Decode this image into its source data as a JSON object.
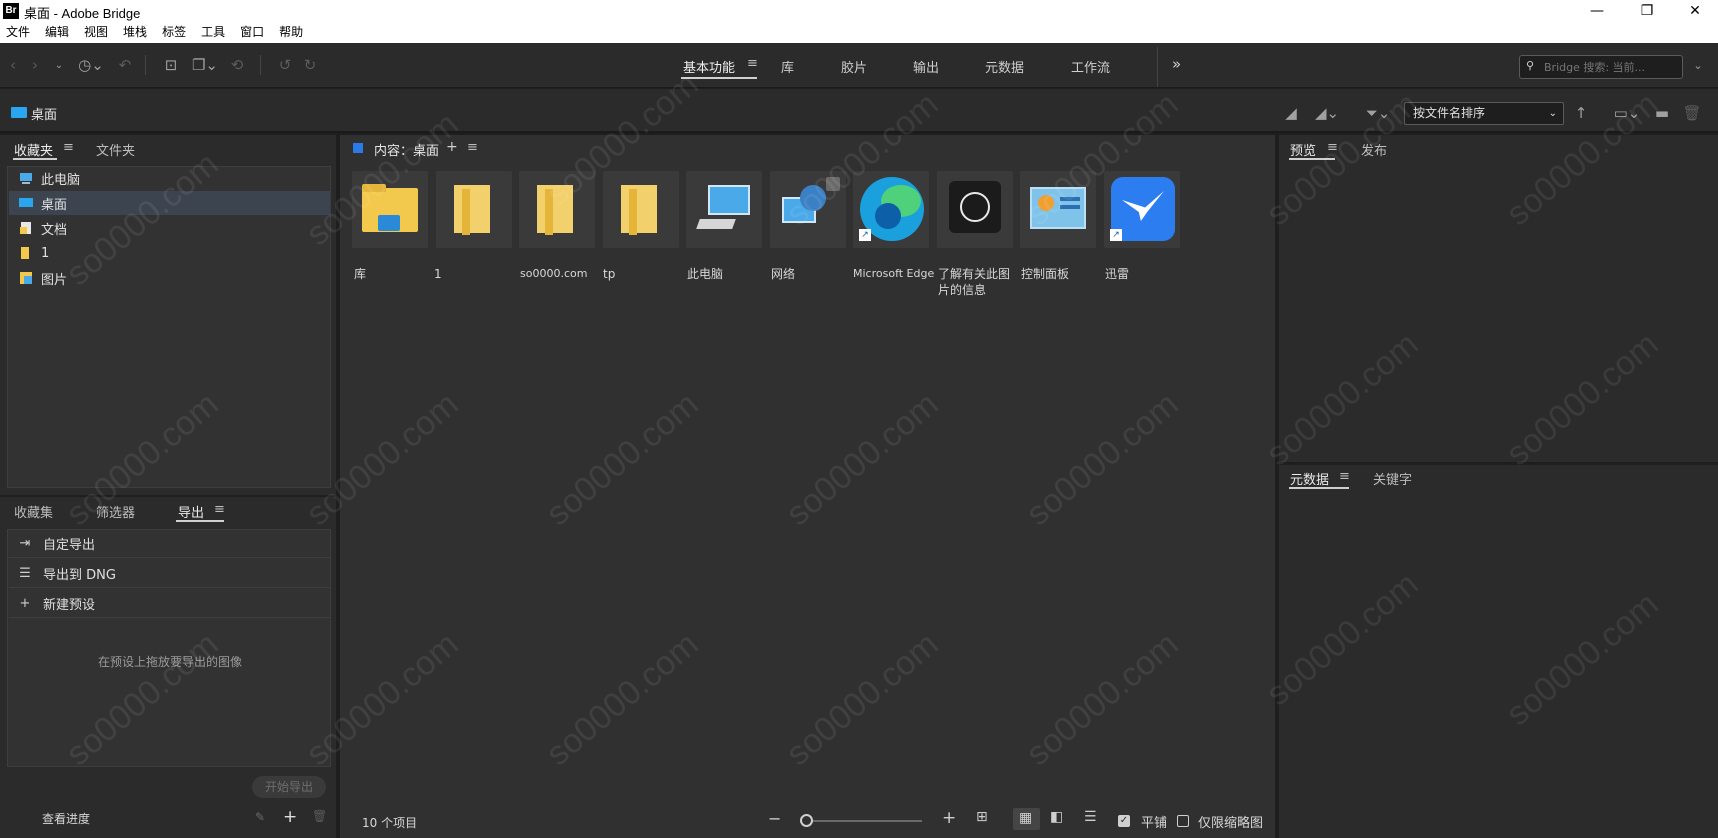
{
  "window": {
    "app_logo": "Br",
    "title": "桌面 - Adobe Bridge"
  },
  "menu": [
    "文件",
    "编辑",
    "视图",
    "堆栈",
    "标签",
    "工具",
    "窗口",
    "帮助"
  ],
  "workspaces": {
    "items": [
      "基本功能",
      "库",
      "胶片",
      "输出",
      "元数据",
      "工作流"
    ],
    "active": "基本功能",
    "more": "»"
  },
  "search": {
    "placeholder": "Bridge 搜索: 当前..."
  },
  "path": {
    "current": "桌面"
  },
  "sort": {
    "label": "按文件名排序"
  },
  "left_top_panel": {
    "tabs": [
      "收藏夹",
      "文件夹"
    ],
    "active_tab": "收藏夹",
    "favorites": [
      {
        "label": "此电脑",
        "icon": "computer-icon"
      },
      {
        "label": "桌面",
        "icon": "desktop-icon",
        "selected": true
      },
      {
        "label": "文档",
        "icon": "document-icon"
      },
      {
        "label": "1",
        "icon": "folder-icon"
      },
      {
        "label": "图片",
        "icon": "picture-icon"
      }
    ]
  },
  "left_bottom_panel": {
    "tabs": [
      "收藏集",
      "筛选器",
      "导出"
    ],
    "active_tab": "导出",
    "export_items": [
      {
        "label": "自定导出",
        "icon": "export-icon"
      },
      {
        "label": "导出到 DNG",
        "icon": "list-icon"
      },
      {
        "label": "新建预设",
        "icon": "plus-icon"
      }
    ],
    "drop_hint": "在预设上拖放要导出的图像",
    "start_export": "开始导出",
    "view_progress": "查看进度"
  },
  "content": {
    "header": "内容：桌面",
    "items": [
      {
        "label": "库",
        "icon": "library-folder-icon"
      },
      {
        "label": "1",
        "icon": "folder-icon"
      },
      {
        "label": "so0000.com",
        "icon": "folder-icon"
      },
      {
        "label": "tp",
        "icon": "folder-icon"
      },
      {
        "label": "此电脑",
        "icon": "computer-icon"
      },
      {
        "label": "网络",
        "icon": "network-icon"
      },
      {
        "label": "Microsoft Edge",
        "icon": "edge-icon"
      },
      {
        "label": "了解有关此图片的信息",
        "icon": "info-picture-icon"
      },
      {
        "label": "控制面板",
        "icon": "control-panel-icon"
      },
      {
        "label": "迅雷",
        "icon": "thunder-icon"
      }
    ],
    "item_count": "10 个项目"
  },
  "right_top_panel": {
    "tabs": [
      "预览",
      "发布"
    ],
    "active_tab": "预览"
  },
  "right_bottom_panel": {
    "tabs": [
      "元数据",
      "关键字"
    ],
    "active_tab": "元数据"
  },
  "status": {
    "tile_label": "平铺",
    "tile_checked": true,
    "thumbs_only_label": "仅限缩略图",
    "thumbs_only_checked": false
  },
  "watermark": "so0000.com",
  "colors": {
    "accent": "#2aa6f0",
    "panel_bg": "#2b2b2b",
    "content_bg": "#303030"
  }
}
